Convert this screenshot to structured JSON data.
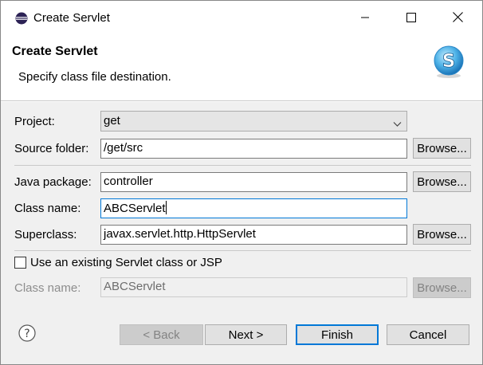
{
  "window": {
    "title": "Create Servlet",
    "app_icon": "eclipse-icon",
    "controls": {
      "minimize": "minimize-icon",
      "maximize": "maximize-icon",
      "close": "close-icon"
    }
  },
  "banner": {
    "title": "Create Servlet",
    "description": "Specify class file destination.",
    "logo": "servlet-s-logo-icon"
  },
  "form": {
    "project": {
      "label": "Project:",
      "value": "get"
    },
    "source_folder": {
      "label": "Source folder:",
      "value": "/get/src",
      "button": "Browse..."
    },
    "java_package": {
      "label": "Java package:",
      "value": "controller",
      "button": "Browse..."
    },
    "class_name": {
      "label": "Class name:",
      "value": "ABCServlet"
    },
    "superclass": {
      "label": "Superclass:",
      "value": "javax.servlet.http.HttpServlet",
      "button": "Browse..."
    },
    "use_existing": {
      "label": "Use an existing Servlet class or JSP",
      "checked": false
    },
    "existing_class_name": {
      "label": "Class name:",
      "value": "ABCServlet",
      "button": "Browse..."
    }
  },
  "footer": {
    "help_icon": "help-icon",
    "back": "< Back",
    "next": "Next >",
    "finish": "Finish",
    "cancel": "Cancel"
  },
  "colors": {
    "accent": "#0078d7",
    "dialog_bg": "#f0f0f0",
    "button_bg": "#e1e1e1"
  }
}
